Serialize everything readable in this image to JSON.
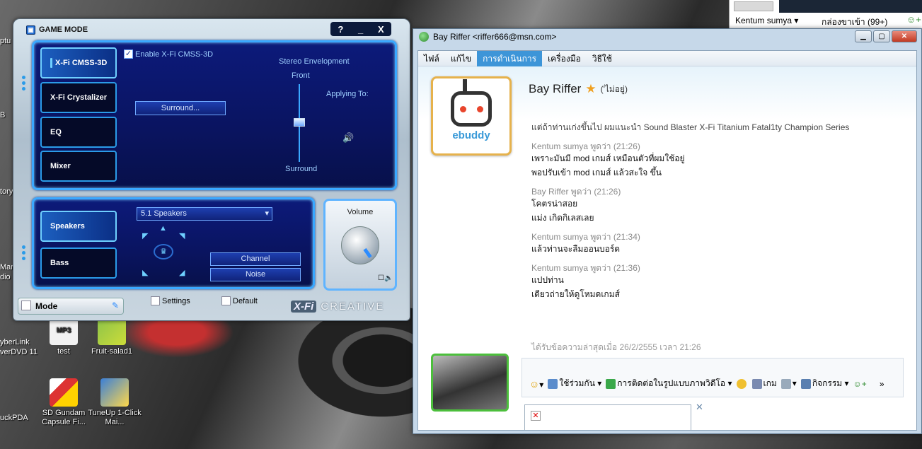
{
  "desktop": {
    "icons": [
      {
        "label": "test"
      },
      {
        "label": "Fruit-salad1"
      },
      {
        "label": "SD Gundam Capsule Fi..."
      },
      {
        "label": "TuneUp 1-Click Mai..."
      }
    ],
    "edge_labels": [
      "ptu",
      "B",
      "tory",
      "Mar",
      "dio",
      "yberLink",
      "verDVD 11",
      "uckPDA"
    ]
  },
  "creative": {
    "title": "GAME MODE",
    "window_controls": {
      "help": "?",
      "minimize": "_",
      "close": "X"
    },
    "tabs": [
      "X-Fi CMSS-3D",
      "X-Fi Crystalizer",
      "EQ",
      "Mixer"
    ],
    "active_tab": "X-Fi CMSS-3D",
    "enable_label": "Enable X-Fi CMSS-3D",
    "enable_checked": true,
    "surround_button": "Surround...",
    "stereo_envelopment": "Stereo Envelopment",
    "front_label": "Front",
    "surround_label": "Surround",
    "applying_to": "Applying To:",
    "output_tabs": [
      "Speakers",
      "Bass"
    ],
    "speaker_config": "5.1 Speakers",
    "channel_button": "Channel",
    "noise_button": "Noise",
    "volume_label": "Volume",
    "mode_label": "Mode",
    "settings_label": "Settings",
    "default_label": "Default",
    "logo_xfi": "X-Fi",
    "logo_creative": "CREATIVE"
  },
  "msn": {
    "title": "Bay Riffer <riffer666@msn.com>",
    "menu": [
      "ไฟล์",
      "แก้ไข",
      "การดำเนินการ",
      "เครื่องมือ",
      "วิธีใช้"
    ],
    "menu_selected": "การดำเนินการ",
    "contact": {
      "name": "Bay Riffer",
      "status": "('ไม่อยู่)"
    },
    "avatar_brand": "ebuddy",
    "messages": [
      {
        "header": null,
        "lines": [
          "แต่ถ้าท่านเก่งขึ้นไป ผมแนะนำ Sound Blaster X-Fi Titanium Fatal1ty Champion Series"
        ]
      },
      {
        "header": "Kentum sumya พูดว่า (21:26)",
        "lines": [
          "เพราะมันมี mod เกมส์ เหมือนตัวที่ผมใช้อยู่",
          "พอปรับเข้า mod เกมส์ แล้วสะใจ ขึ้น"
        ]
      },
      {
        "header": "Bay Riffer พูดว่า (21:26)",
        "lines": [
          "โคตรน่าสอย",
          "แม่ง เกิดกิเลสเลย"
        ]
      },
      {
        "header": "Kentum sumya พูดว่า (21:34)",
        "lines": [
          "แล้วท่านจะลืมออนบอร์ด"
        ]
      },
      {
        "header": "Kentum sumya พูดว่า (21:36)",
        "lines": [
          "แปปท่าน",
          "เดียวถ่ายให้ดูโหมดเกมส์"
        ]
      }
    ],
    "last_received": "ได้รับข้อความล่าสุดเมื่อ 26/2/2555 เวลา 21:26",
    "toolbar": {
      "share": "ใช้ร่วมกัน",
      "video_call": "การติดต่อในรูปแบบภาพวิดีโอ",
      "games": "เกม",
      "activities": "กิจกรรม",
      "more": "»"
    }
  },
  "top_right": {
    "user": "Kentum sumya",
    "inbox": "กล่องขาเข้า (99+)"
  }
}
